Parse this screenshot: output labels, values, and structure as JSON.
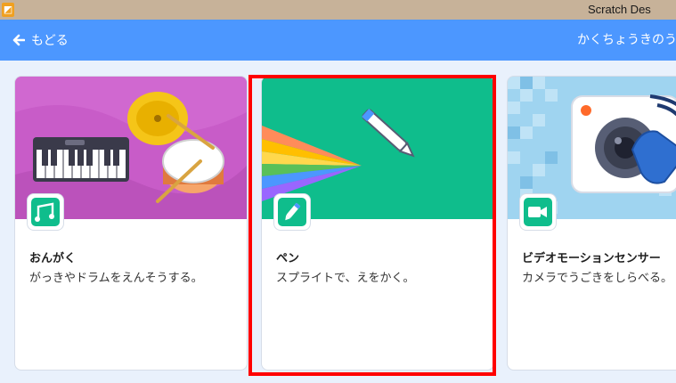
{
  "titlebar": {
    "app_title": "Scratch Des"
  },
  "header": {
    "back_label": "もどる",
    "title": "かくちょうきのう"
  },
  "extensions": [
    {
      "name": "おんがく",
      "description": "がっきやドラムをえんそうする。"
    },
    {
      "name": "ペン",
      "description": "スプライトで、えをかく。"
    },
    {
      "name": "ビデオモーションセンサー",
      "description": "カメラでうごきをしらべる。"
    }
  ],
  "highlight": {
    "target": "ペン",
    "color": "#ff0000"
  },
  "colors": {
    "header": "#4c97ff",
    "icon_bg": "#0fbd8c",
    "music_bg": "#c85cc8",
    "pen_bg": "#0fbd8c",
    "video_bg": "#9fd4f0"
  }
}
